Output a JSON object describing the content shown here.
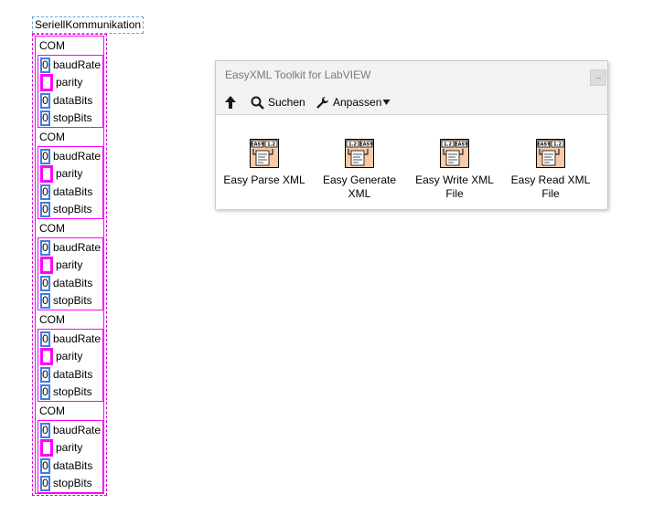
{
  "cluster": {
    "title": "SeriellKommunikation",
    "items": [
      {
        "label": "COM",
        "baudRate": "0",
        "dataBits": "0",
        "stopBits": "0"
      },
      {
        "label": "COM",
        "baudRate": "0",
        "dataBits": "0",
        "stopBits": "0"
      },
      {
        "label": "COM",
        "baudRate": "0",
        "dataBits": "0",
        "stopBits": "0"
      },
      {
        "label": "COM",
        "baudRate": "0",
        "dataBits": "0",
        "stopBits": "0"
      },
      {
        "label": "COM",
        "baudRate": "0",
        "dataBits": "0",
        "stopBits": "0"
      }
    ],
    "field_labels": {
      "baudRate": "baudRate",
      "parity": "parity",
      "dataBits": "dataBits",
      "stopBits": "stopBits"
    },
    "colors": {
      "border": "#ff00ff",
      "numeric": "#3d7ee0"
    }
  },
  "palette": {
    "title": "EasyXML Toolkit for LabVIEW",
    "toolbar": {
      "up_icon": "arrow-up-icon",
      "search_label": "Suchen",
      "search_icon": "magnifier-icon",
      "customize_label": "Anpassen",
      "customize_icon": "wrench-icon",
      "customize_menu_icon": "triangle-down-icon"
    },
    "items": [
      {
        "label": "Easy Parse XML",
        "icon": "easy-parse-xml-icon",
        "icon_text_left": "EASY",
        "icon_text_right": "1.2"
      },
      {
        "label": "Easy Generate XML",
        "icon": "easy-generate-xml-icon",
        "icon_text_left": "1.2",
        "icon_text_right": "EASY"
      },
      {
        "label": "Easy Write XML File",
        "icon": "easy-write-xml-file-icon",
        "icon_text_left": "1.2",
        "icon_text_right": "EASY"
      },
      {
        "label": "Easy Read XML File",
        "icon": "easy-read-xml-file-icon",
        "icon_text_left": "EASY",
        "icon_text_right": "1.2"
      }
    ]
  }
}
